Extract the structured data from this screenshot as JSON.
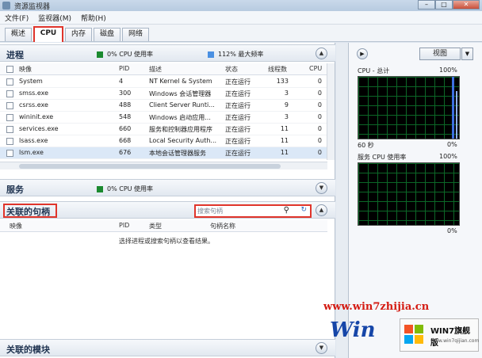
{
  "window": {
    "title": "资源监视器"
  },
  "menu": [
    "文件(F)",
    "监视器(M)",
    "帮助(H)"
  ],
  "tabs": [
    {
      "label": "概述",
      "active": false
    },
    {
      "label": "CPU",
      "active": true
    },
    {
      "label": "内存",
      "active": false
    },
    {
      "label": "磁盘",
      "active": false
    },
    {
      "label": "网络",
      "active": false
    }
  ],
  "process_section": {
    "title": "进程",
    "cpu_usage": "0% CPU 使用率",
    "max_freq": "112% 最大频率",
    "columns": [
      "映像",
      "PID",
      "描述",
      "状态",
      "线程数",
      "CPU"
    ],
    "rows": [
      {
        "image": "System",
        "pid": "4",
        "desc": "NT Kernel & System",
        "status": "正在运行",
        "threads": "133",
        "cpu": "0"
      },
      {
        "image": "smss.exe",
        "pid": "300",
        "desc": "Windows 会话管理器",
        "status": "正在运行",
        "threads": "3",
        "cpu": "0"
      },
      {
        "image": "csrss.exe",
        "pid": "488",
        "desc": "Client Server Runti...",
        "status": "正在运行",
        "threads": "9",
        "cpu": "0"
      },
      {
        "image": "wininit.exe",
        "pid": "548",
        "desc": "Windows 启动应用...",
        "status": "正在运行",
        "threads": "3",
        "cpu": "0"
      },
      {
        "image": "services.exe",
        "pid": "660",
        "desc": "服务和控制器应用程序",
        "status": "正在运行",
        "threads": "11",
        "cpu": "0"
      },
      {
        "image": "lsass.exe",
        "pid": "668",
        "desc": "Local Security Auth...",
        "status": "正在运行",
        "threads": "11",
        "cpu": "0"
      },
      {
        "image": "lsm.exe",
        "pid": "676",
        "desc": "本地会话管理器服务",
        "status": "正在运行",
        "threads": "11",
        "cpu": "0"
      }
    ]
  },
  "services_section": {
    "title": "服务",
    "cpu_usage": "0% CPU 使用率"
  },
  "handles_section": {
    "title": "关联的句柄",
    "search_placeholder": "搜索句柄",
    "columns": [
      "映像",
      "PID",
      "类型",
      "句柄名称"
    ],
    "empty_message": "选择进程或搜索句柄以查看结果。"
  },
  "modules_section": {
    "title": "关联的模块"
  },
  "right_panel": {
    "view_label": "视图",
    "graph1": {
      "title": "CPU - 总计",
      "max": "100%",
      "time": "60 秒",
      "min": "0%"
    },
    "graph2": {
      "title": "服务 CPU 使用率",
      "max": "100%",
      "min": "0%"
    }
  },
  "watermark": {
    "url": "www.win7zhijia.cn",
    "brand": "Win",
    "badge_name": "WIN7旗舰版",
    "badge_site": "www.win7qijian.com"
  },
  "colors": {
    "highlight_red": "#e0352b",
    "cpu_green": "#1b8a2f",
    "freq_blue": "#4a90e2",
    "graph_bg": "#000000",
    "graph_grid": "#0f7a2e"
  }
}
